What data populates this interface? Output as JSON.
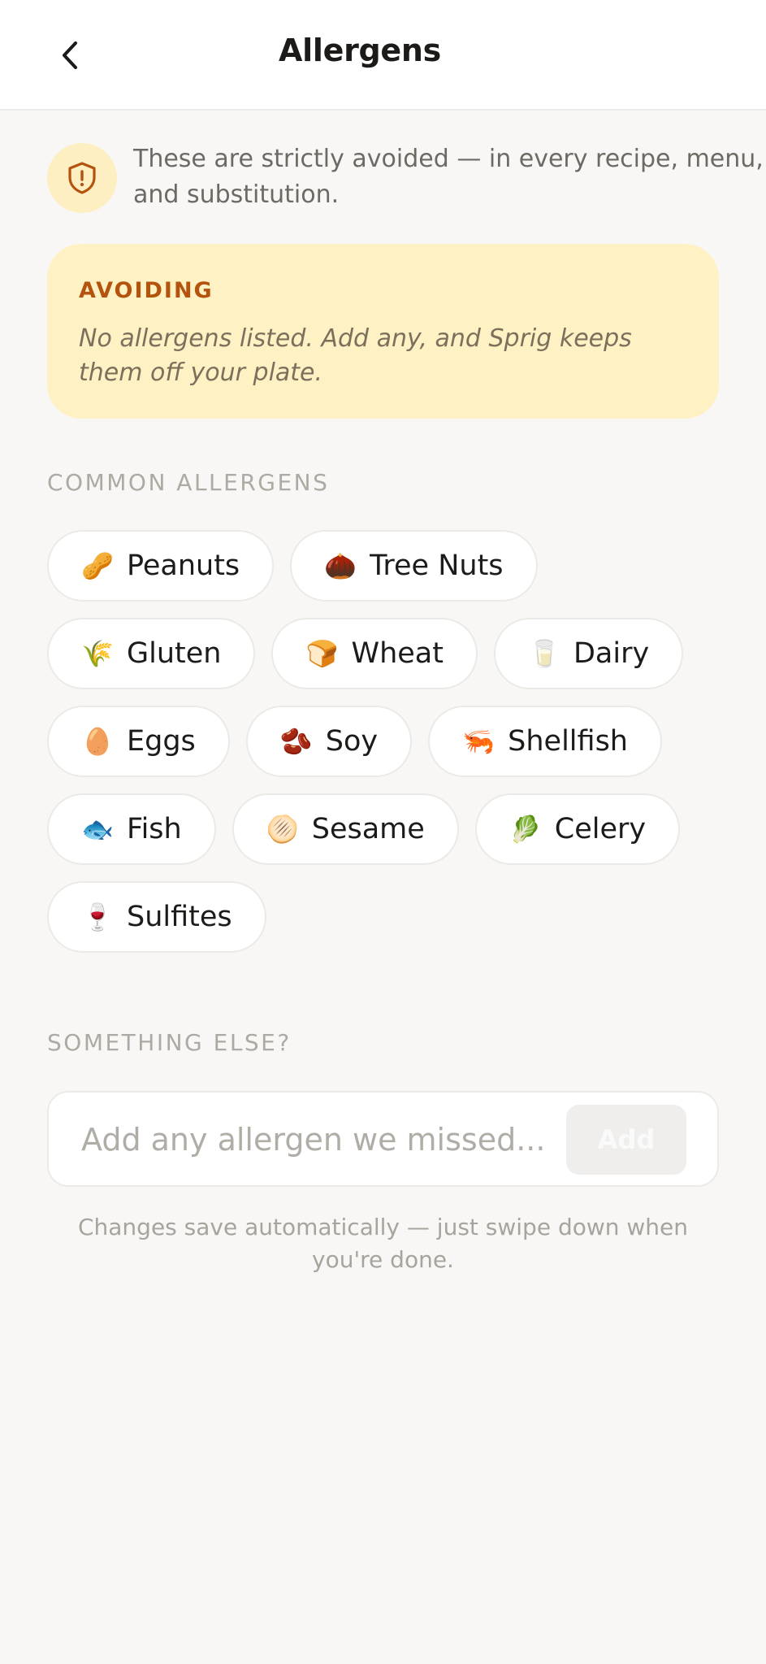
{
  "header": {
    "title": "Allergens",
    "back_icon": "chevron-left-icon"
  },
  "intro": {
    "icon": "shield-alert-icon",
    "text": "These are strictly avoided — in every recipe, menu, and substitution."
  },
  "avoiding": {
    "label": "AVOIDING",
    "empty_text": "No allergens listed. Add any, and Sprig keeps them off your plate."
  },
  "common": {
    "label": "COMMON ALLERGENS",
    "chips": [
      {
        "icon": "🥜",
        "label": "Peanuts"
      },
      {
        "icon": "🌰",
        "label": "Tree Nuts"
      },
      {
        "icon": "🌾",
        "label": "Gluten"
      },
      {
        "icon": "🍞",
        "label": "Wheat"
      },
      {
        "icon": "🥛",
        "label": "Dairy"
      },
      {
        "icon": "🥚",
        "label": "Eggs"
      },
      {
        "icon": "🫘",
        "label": "Soy"
      },
      {
        "icon": "🦐",
        "label": "Shellfish"
      },
      {
        "icon": "🐟",
        "label": "Fish"
      },
      {
        "icon": "🫓",
        "label": "Sesame"
      },
      {
        "icon": "🥬",
        "label": "Celery"
      },
      {
        "icon": "🍷",
        "label": "Sulfites"
      }
    ]
  },
  "custom": {
    "label": "SOMETHING ELSE?",
    "placeholder": "Add any allergen we missed...",
    "value": "",
    "add_label": "Add"
  },
  "footer": {
    "note": "Changes save automatically — just swipe down when you're done."
  },
  "colors": {
    "background": "#f8f7f5",
    "accent": "#b4530e",
    "card": "#fef1c3"
  }
}
